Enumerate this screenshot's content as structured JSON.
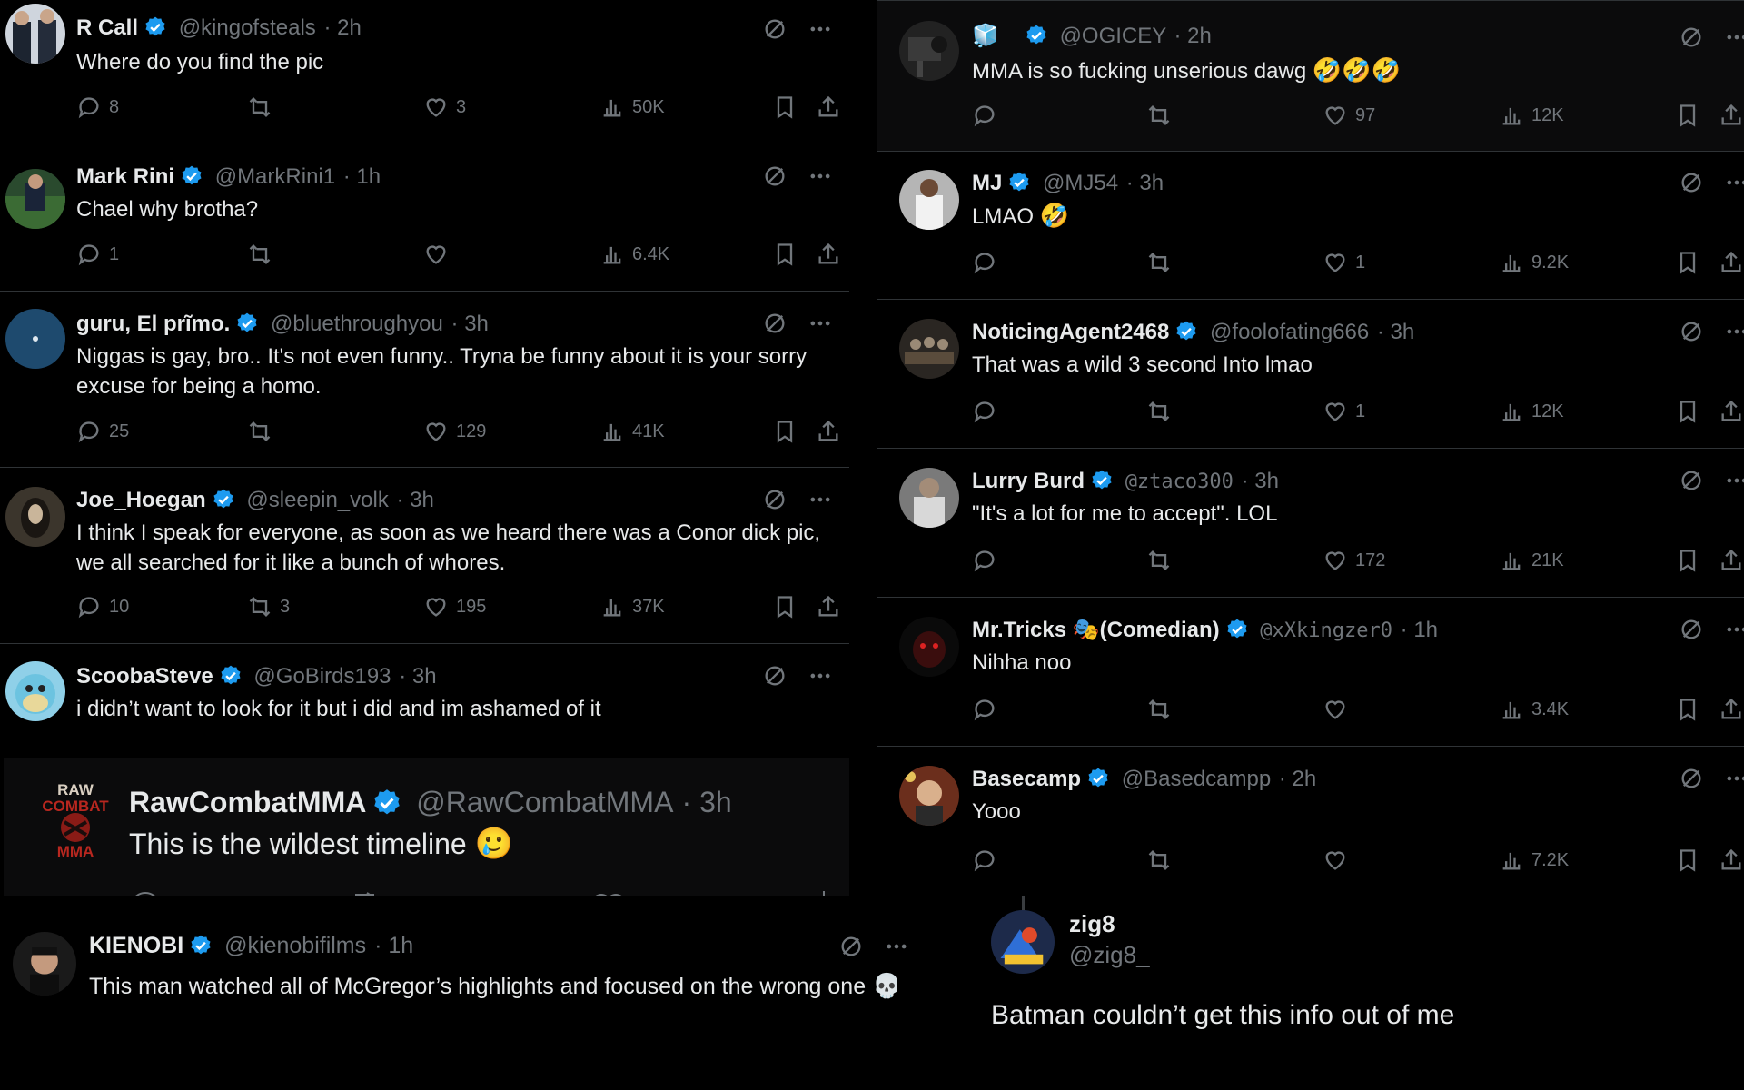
{
  "left_tweets": [
    {
      "name": "R Call",
      "handle": "@kingofsteals",
      "time": "· 2h",
      "text": "Where do you find the pic",
      "replies": "8",
      "retweets": "",
      "likes": "3",
      "views": "50K"
    },
    {
      "name": "Mark Rini",
      "handle": "@MarkRini1",
      "time": "· 1h",
      "text": "Chael why brotha?",
      "replies": "1",
      "retweets": "",
      "likes": "",
      "views": "6.4K"
    },
    {
      "name": "guru, El prĩmo.",
      "handle": "@bluethroughyou",
      "time": "· 3h",
      "text": "Niggas is gay, bro.. It's not even funny.. Tryna be funny about it is your sorry excuse for being a homo.",
      "replies": "25",
      "retweets": "",
      "likes": "129",
      "views": "41K"
    },
    {
      "name": "Joe_Hoegan",
      "handle": "@sleepin_volk",
      "time": "· 3h",
      "text": "I think I speak for everyone, as soon as we heard there was a Conor dick pic, we all searched for it like a bunch of whores.",
      "replies": "10",
      "retweets": "3",
      "likes": "195",
      "views": "37K"
    },
    {
      "name": "ScoobaSteve",
      "handle": "@GoBirds193",
      "time": "· 3h",
      "text": "i didn’t want to look for it but i did and im ashamed of it"
    }
  ],
  "quoted_tweet": {
    "name": "RawCombatMMA",
    "handle": "@RawCombatMMA",
    "time": "· 3h",
    "text": "This is the wildest timeline",
    "emoji": "🥲",
    "logo_text": "RAW COMBAT MMA"
  },
  "right_tweets": [
    {
      "name": "🧊",
      "handle": "@OGICEY",
      "time": "· 2h",
      "text": "MMA is so fucking unserious dawg",
      "emoji": "🤣🤣🤣",
      "replies": "",
      "retweets": "",
      "likes": "97",
      "views": "12K"
    },
    {
      "name": "MJ",
      "handle": "@MJ54",
      "time": "· 3h",
      "text": "LMAO",
      "emoji": "🤣",
      "replies": "",
      "retweets": "",
      "likes": "1",
      "views": "9.2K"
    },
    {
      "name": "NoticingAgent2468",
      "handle": "@foolofating666",
      "time": "· 3h",
      "text": "That was a wild 3 second Into lmao",
      "replies": "",
      "retweets": "",
      "likes": "1",
      "views": "12K"
    },
    {
      "name": "Lurry Burd",
      "handle": "@ztaco300",
      "time": "· 3h",
      "text": "\"It's a lot for me to accept\". LOL",
      "replies": "",
      "retweets": "",
      "likes": "172",
      "views": "21K"
    },
    {
      "name": "Mr.Tricks 🎭(Comedian)",
      "handle": "@xXkingzer0",
      "time": "· 1h",
      "text": "Nihha noo",
      "replies": "",
      "retweets": "",
      "likes": "",
      "views": "3.4K"
    },
    {
      "name": "Basecamp",
      "handle": "@Basedcampp",
      "time": "· 2h",
      "text": "Yooo",
      "replies": "",
      "retweets": "",
      "likes": "",
      "views": "7.2K"
    }
  ],
  "bottom_left_tweet": {
    "name": "KIENOBI",
    "handle": "@kienobifilms",
    "time": "· 1h",
    "text": "This man watched all of McGregor’s highlights and focused on the wrong one",
    "emoji": "💀"
  },
  "bottom_right_tweet": {
    "name": "zig8",
    "handle": "@zig8_",
    "text": "Batman couldn’t get this info out of me"
  },
  "colors": {
    "background": "#000000",
    "text": "#e7e9ea",
    "muted": "#71767b",
    "verified": "#1d9bf0",
    "divider": "#2f3336"
  },
  "icons": [
    "reply-icon",
    "retweet-icon",
    "like-icon",
    "views-icon",
    "bookmark-icon",
    "share-icon",
    "grok-icon",
    "more-icon",
    "verified-badge-icon"
  ]
}
